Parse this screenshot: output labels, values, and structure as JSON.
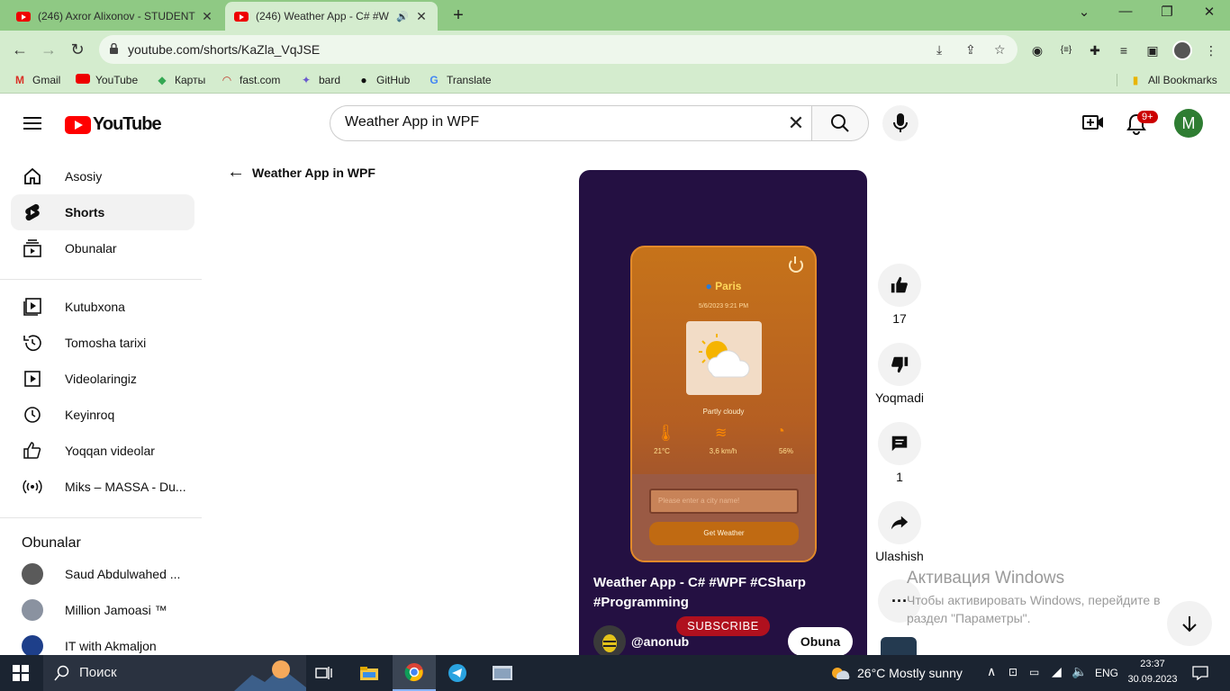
{
  "browser": {
    "tabs": [
      {
        "title": "(246) Axror Alixonov - STUDENT",
        "active": false
      },
      {
        "title": "(246) Weather App - C# #W",
        "active": true
      }
    ],
    "url": "youtube.com/shorts/KaZla_VqJSE",
    "bookmarks": [
      "Gmail",
      "YouTube",
      "Карты",
      "fast.com",
      "bard",
      "GitHub",
      "Translate"
    ],
    "all_bookmarks": "All Bookmarks"
  },
  "youtube": {
    "logo": "YouTube",
    "search_value": "Weather App in WPF",
    "notification_badge": "9+",
    "avatar_letter": "M"
  },
  "sidebar": {
    "main": [
      {
        "label": "Asosiy",
        "icon": "home-icon"
      },
      {
        "label": "Shorts",
        "icon": "shorts-icon"
      },
      {
        "label": "Obunalar",
        "icon": "subscriptions-icon"
      }
    ],
    "library": [
      {
        "label": "Kutubxona",
        "icon": "library-icon"
      },
      {
        "label": "Tomosha tarixi",
        "icon": "history-icon"
      },
      {
        "label": "Videolaringiz",
        "icon": "your-videos-icon"
      },
      {
        "label": "Keyinroq",
        "icon": "watch-later-icon"
      },
      {
        "label": "Yoqqan videolar",
        "icon": "liked-icon"
      },
      {
        "label": "Miks – MASSA - Du...",
        "icon": "mix-icon"
      }
    ],
    "subs_heading": "Obunalar",
    "subscriptions": [
      "Saud Abdulwahed ...",
      "Million Jamoasi ™",
      "IT with Akmaljon"
    ]
  },
  "back_link": "Weather App in WPF",
  "short": {
    "app": {
      "city": "Paris",
      "datetime": "5/6/2023 9:21 PM",
      "condition": "Partly cloudy",
      "temperature": "21°C",
      "wind": "3,6 km/h",
      "humidity": "56%",
      "input_placeholder": "Please enter a city name!",
      "button": "Get Weather"
    },
    "title": "Weather App - C# #WPF #CSharp #Programming",
    "subscribe_overlay": "SUBSCRIBE",
    "channel": "@anonub",
    "subscribe_button": "Obuna"
  },
  "actions": {
    "likes": "17",
    "dislike_label": "Yoqmadi",
    "comments": "1",
    "share_label": "Ulashish"
  },
  "watermark": {
    "line1": "Активация Windows",
    "line2": "Чтобы активировать Windows, перейдите в",
    "line3": "раздел \"Параметры\"."
  },
  "taskbar": {
    "search": "Поиск",
    "weather": "26°C  Mostly sunny",
    "lang": "ENG",
    "time": "23:37",
    "date": "30.09.2023"
  }
}
